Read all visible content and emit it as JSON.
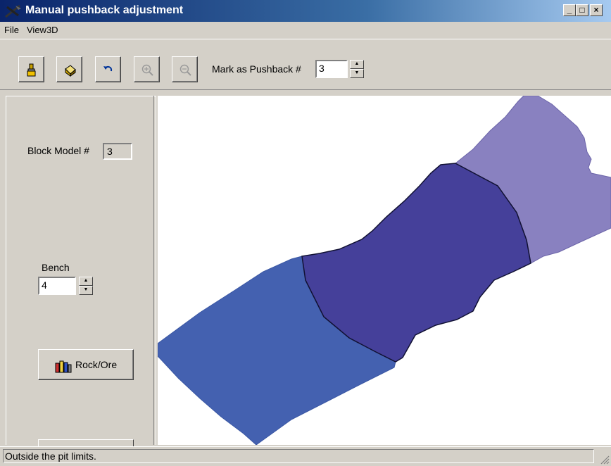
{
  "window": {
    "title": "Manual pushback adjustment",
    "controls": [
      "_",
      "□",
      "×"
    ]
  },
  "menu": {
    "items": [
      "File",
      "View3D"
    ]
  },
  "toolbar": {
    "buttons": [
      {
        "name": "paint-brush-icon"
      },
      {
        "name": "fill-bucket-icon"
      },
      {
        "name": "undo-icon"
      },
      {
        "name": "zoom-in-icon"
      },
      {
        "name": "zoom-out-icon"
      }
    ],
    "mark_label": "Mark as Pushback #",
    "mark_value": "3"
  },
  "panel": {
    "block_model_label": "Block Model #",
    "block_model_value": "3",
    "bench_label": "Bench",
    "bench_value": "4",
    "rock_ore_label": "Rock/Ore"
  },
  "canvas": {
    "colors": {
      "pushback_1": "#4461b0",
      "pushback_2": "#45409a",
      "pushback_3": "#8981c0",
      "background": "#ffffff"
    }
  },
  "status": {
    "text": "Outside the pit limits."
  }
}
